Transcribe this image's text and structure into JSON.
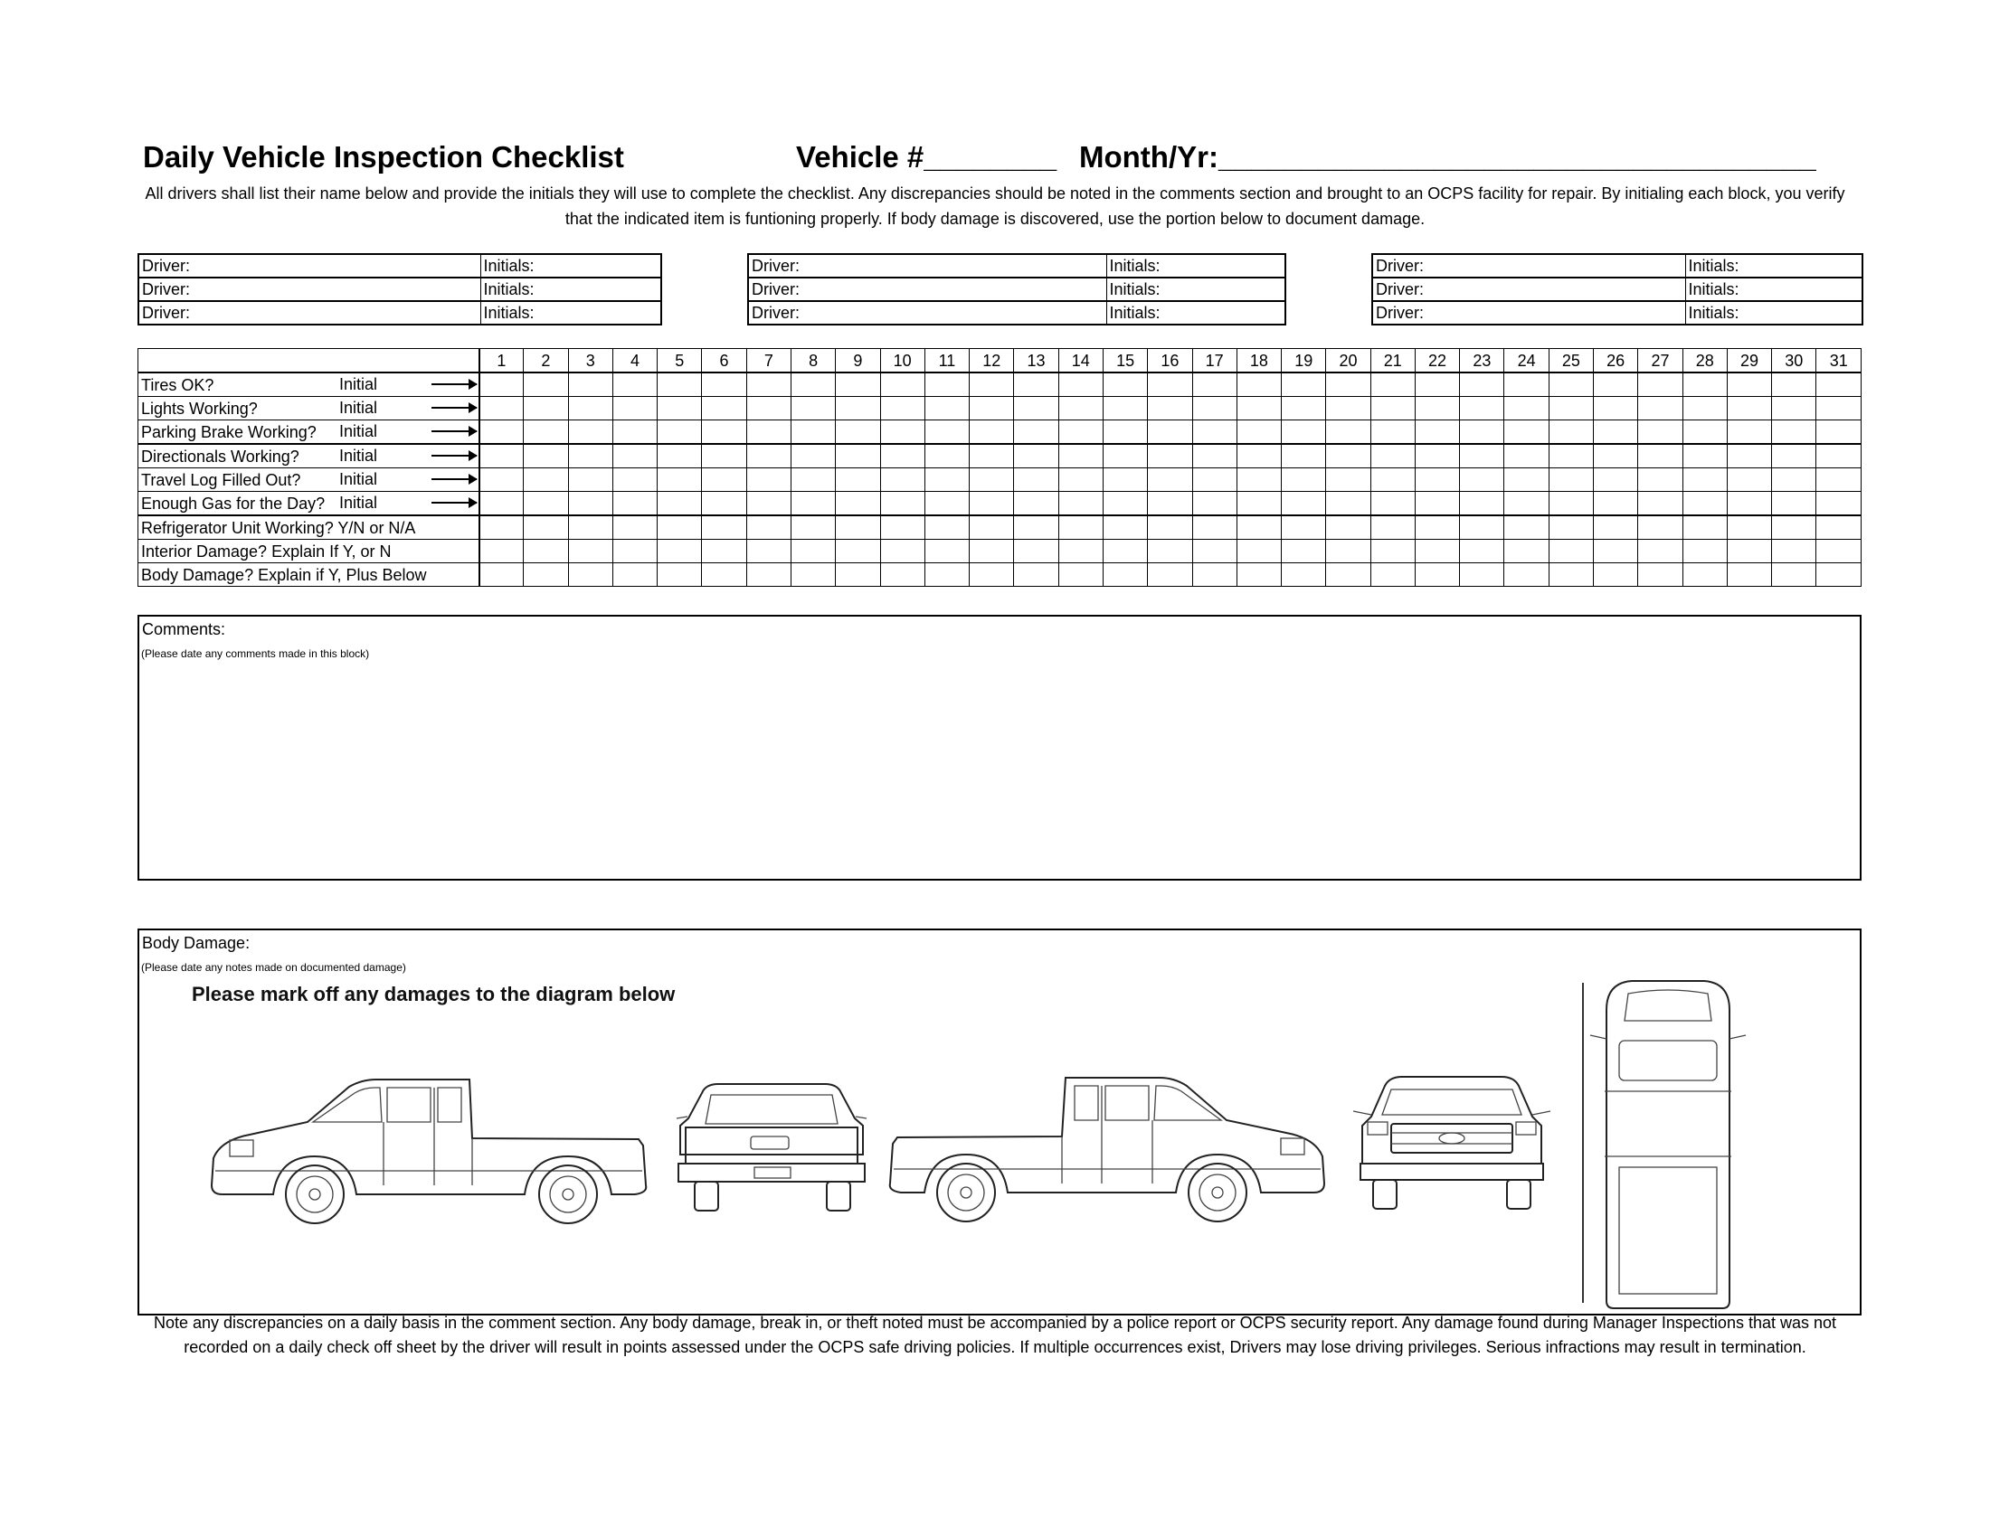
{
  "header": {
    "title": "Daily Vehicle Inspection Checklist",
    "vehicle": "Vehicle #________",
    "month": "Month/Yr:____________________________________"
  },
  "intro": "All drivers shall list their name below and provide the initials they will use to complete the checklist.  Any discrepancies should be noted in the comments section and brought to an OCPS facility for repair.  By initialing each block, you verify that the indicated item is funtioning properly.  If body damage is discovered, use the portion below to document damage.",
  "drivers": {
    "driver_label": "Driver:",
    "initials_label": "Initials:"
  },
  "checklist": {
    "days": [
      "1",
      "2",
      "3",
      "4",
      "5",
      "6",
      "7",
      "8",
      "9",
      "10",
      "11",
      "12",
      "13",
      "14",
      "15",
      "16",
      "17",
      "18",
      "19",
      "20",
      "21",
      "22",
      "23",
      "24",
      "25",
      "26",
      "27",
      "28",
      "29",
      "30",
      "31"
    ],
    "initial_label": "Initial",
    "rows": [
      {
        "label": "Tires OK?"
      },
      {
        "label": "Lights Working?"
      },
      {
        "label": "Parking Brake Working?"
      },
      {
        "label": "Directionals Working?"
      },
      {
        "label": "Travel Log Filled Out?"
      },
      {
        "label": "Enough Gas for the Day?"
      },
      {
        "label": "Refrigerator Unit Working?  Y/N or N/A"
      },
      {
        "label": "Interior Damage?  Explain If Y, or N"
      },
      {
        "label": "Body Damage?  Explain if Y, Plus Below"
      }
    ]
  },
  "comments": {
    "title": "Comments:",
    "note": "(Please date any comments made in this block)"
  },
  "body_damage": {
    "title": "Body Damage:",
    "note": "(Please date any notes made on documented damage)",
    "instruction": "Please mark off any damages to the diagram below"
  },
  "footer": "Note any discrepancies on a daily basis in the comment section.  Any body damage, break in, or theft noted must be accompanied by a police report or OCPS security report.  Any damage found during Manager Inspections that was not recorded on a daily check off sheet by the driver will result in points assessed under the OCPS safe driving policies.  If multiple occurrences exist, Drivers may lose driving privileges.  Serious infractions may result in termination."
}
